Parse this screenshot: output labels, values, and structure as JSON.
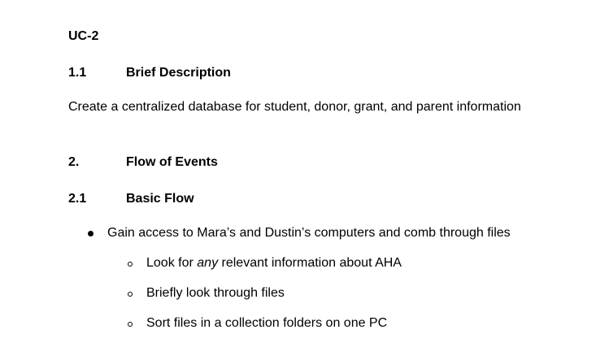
{
  "document": {
    "doc_id": "UC-2",
    "sections": [
      {
        "number": "1.1",
        "title": "Brief Description"
      },
      {
        "number": "2.",
        "title": "Flow of Events"
      },
      {
        "number": "2.1",
        "title": "Basic Flow"
      }
    ],
    "description": "Create a centralized database for student, donor, grant, and parent information",
    "bullet": "Gain access to Mara’s and Dustin’s computers and comb through files",
    "subbullets": [
      {
        "before": "Look for ",
        "emphasis": "any",
        "after": " relevant information about AHA"
      },
      {
        "text": "Briefly look through files"
      },
      {
        "text": "Sort files in a collection folders on one PC"
      }
    ]
  }
}
